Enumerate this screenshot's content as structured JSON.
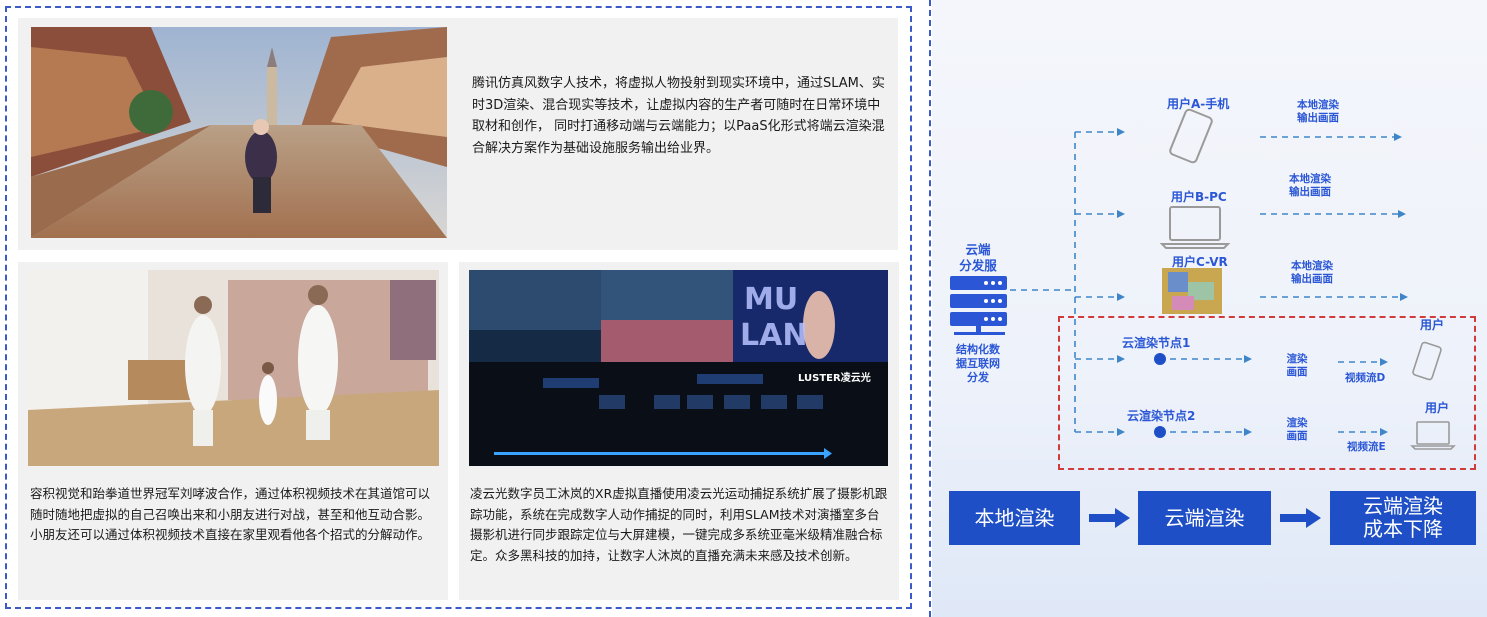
{
  "left": {
    "top_caption": "腾讯仿真风数字人技术，将虚拟人物投射到现实环境中，通过SLAM、实时3D渲染、混合现实等技术，让虚拟内容的生产者可随时在日常环境中取材和创作， 同时打通移动端与云端能力；以PaaS化形式将端云渲染混合解决方案作为基础设施服务输出给业界。",
    "bottom_left_caption": "容积视觉和跆拳道世界冠军刘哮波合作，通过体积视频技术在其道馆可以随时随地把虚拟的自己召唤出来和小朋友进行对战，甚至和他互动合影。小朋友还可以通过体积视频技术直接在家里观看他各个招式的分解动作。",
    "bottom_right_caption": "凌云光数字员工沐岚的XR虚拟直播使用凌云光运动捕捉系统扩展了摄影机跟踪功能，系统在完成数字人动作捕捉的同时，利用SLAM技术对演播室多台摄影机进行同步跟踪定位与大屏建模，一键完成多系统亚毫米级精准融合标定。众多黑科技的加持，让数字人沐岚的直播充满未来感及技术创新。",
    "photo_texts": {
      "luster_logo": "LUSTER凌云光",
      "mulan_word_1": "MU",
      "mulan_word_2": "LAN"
    }
  },
  "diagram": {
    "server_title": "云端\n分发服",
    "server_caption": "结构化数\n据互联网\n分发",
    "users": [
      {
        "label": "用户A-手机",
        "render_label": "本地渲染\n输出画面"
      },
      {
        "label": "用户B-PC",
        "render_label": "本地渲染\n输出画面"
      },
      {
        "label": "用户C-VR",
        "render_label": "本地渲染\n输出画面"
      }
    ],
    "cloud_nodes": [
      {
        "label": "云渲染节点1",
        "render": "渲染\n画面",
        "stream": "视频流D",
        "user": "用户"
      },
      {
        "label": "云渲染节点2",
        "render": "渲染\n画面",
        "stream": "视频流E",
        "user": "用户"
      }
    ],
    "flow": [
      "本地渲染",
      "云端渲染",
      "云端渲染\n成本下降"
    ]
  },
  "colors": {
    "accent_blue": "#2b57d6",
    "flow_blue": "#1f4fc6",
    "frame_blue": "#3a5bc7",
    "cloud_red": "#d23b3b"
  }
}
